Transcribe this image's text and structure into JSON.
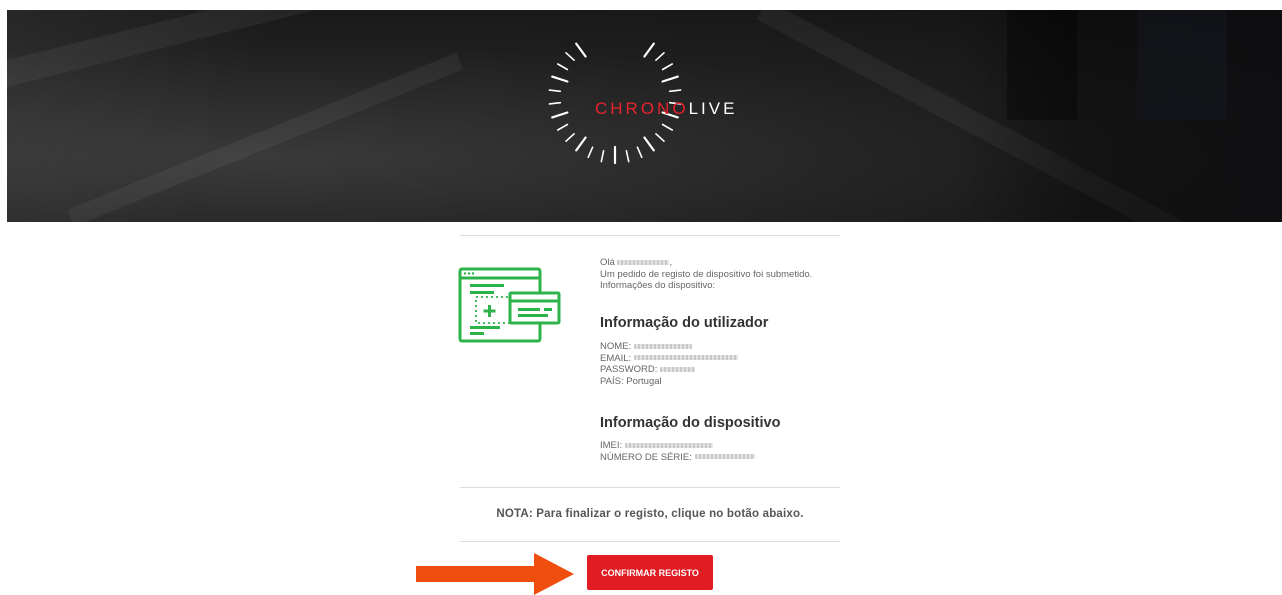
{
  "brand": {
    "part1": "CHRONO",
    "part2": "LIVE",
    "accent_color": "#e8232d"
  },
  "greeting": {
    "hello_prefix": "Olá",
    "hello_suffix": ",",
    "line1": "Um pedido de registo de dispositivo foi submetido.",
    "line2": "Informações do dispositivo:"
  },
  "user_info": {
    "title": "Informação do utilizador",
    "name_label": "NOME:",
    "email_label": "EMAIL:",
    "password_label": "PASSWORD:",
    "country_label": "PAÍS:",
    "country_value": "Portugal"
  },
  "device_info": {
    "title": "Informação do dispositivo",
    "imei_label": "IMEI:",
    "serial_label": "NÚMERO DE SÉRIE:"
  },
  "note": "NOTA: Para finalizar o registo, clique no botão abaixo.",
  "confirm_button": {
    "label": "CONFIRMAR REGISTO",
    "color": "#e11b22"
  },
  "illustration_icon": "device-registration-icon",
  "arrow_color": "#f04e0f"
}
